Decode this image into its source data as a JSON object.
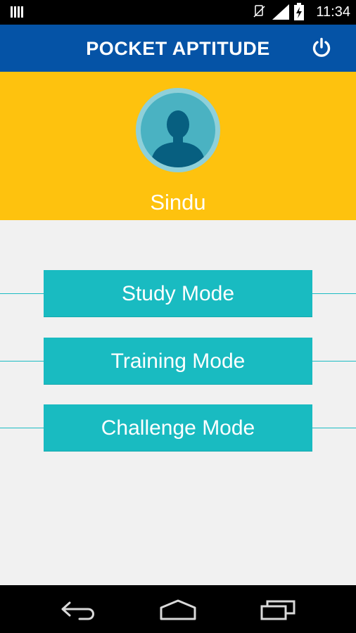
{
  "status_bar": {
    "time": "11:34"
  },
  "app_bar": {
    "title": "POCKET APTITUDE"
  },
  "profile": {
    "name": "Sindu"
  },
  "menu": {
    "study": "Study Mode",
    "training": "Training Mode",
    "challenge": "Challenge Mode"
  },
  "colors": {
    "app_bar": "#0553a6",
    "profile_bg": "#fec20e",
    "button": "#19bbc1",
    "background": "#f1f1f1"
  },
  "icons": {
    "power": "power-icon",
    "back": "back-icon",
    "home": "home-icon",
    "recents": "recents-icon"
  }
}
